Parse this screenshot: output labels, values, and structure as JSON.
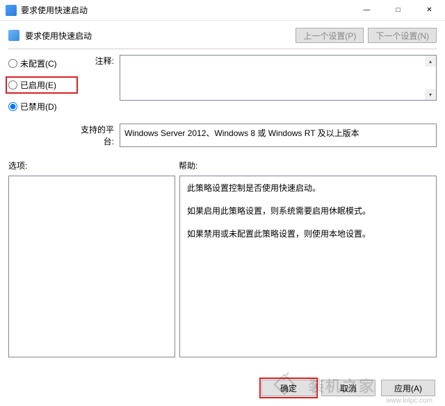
{
  "window": {
    "title": "要求使用快速启动",
    "minimize": "—",
    "maximize": "□",
    "close": "✕"
  },
  "header": {
    "title": "要求使用快速启动",
    "prev": "上一个设置(P)",
    "next": "下一个设置(N)"
  },
  "radios": {
    "not_configured": "未配置(C)",
    "enabled": "已启用(E)",
    "disabled": "已禁用(D)"
  },
  "labels": {
    "comment": "注释:",
    "platform": "支持的平台:",
    "options": "选项:",
    "help": "帮助:"
  },
  "platform_text": "Windows Server 2012、Windows 8 或 Windows RT 及以上版本",
  "help_text": {
    "p1": "此策略设置控制是否使用快速启动。",
    "p2": "如果启用此策略设置，则系统需要启用休眠模式。",
    "p3": "如果禁用或未配置此策略设置，则使用本地设置。"
  },
  "buttons": {
    "ok": "确定",
    "cancel": "取消",
    "apply": "应用(A)"
  },
  "watermark": {
    "text": "装机之家",
    "url": "www.lotpc.com"
  }
}
